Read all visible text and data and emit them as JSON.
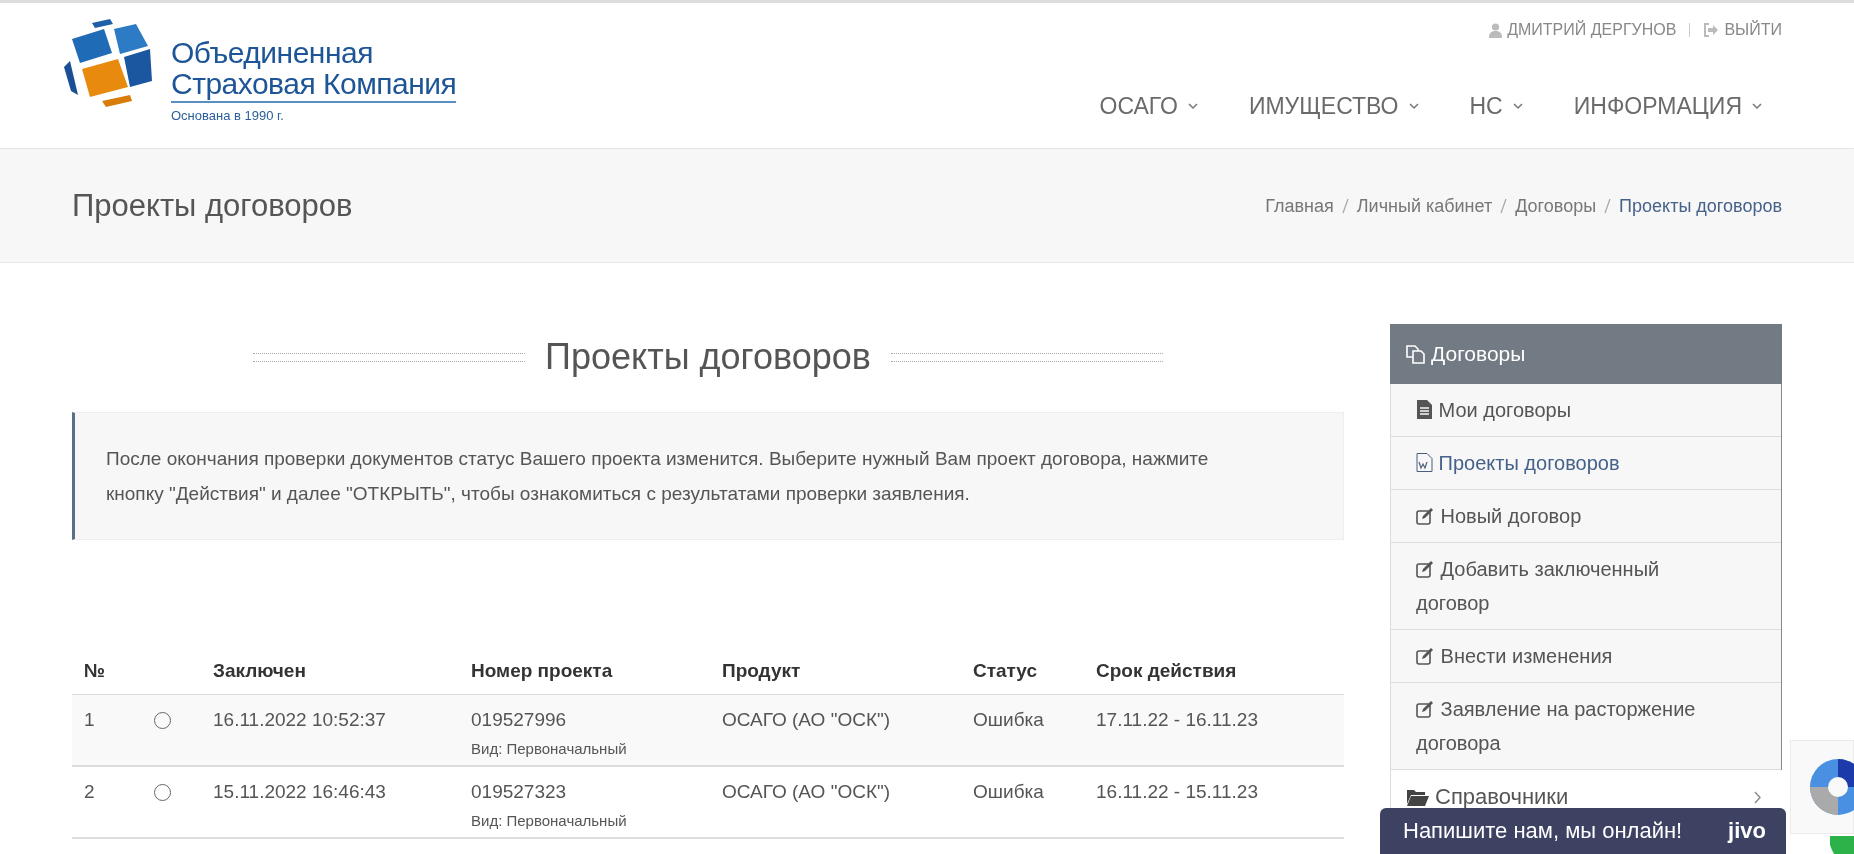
{
  "logo": {
    "line_1": "Объединенная",
    "line_2": "Страховая Компания",
    "tagline": "Основана в 1990 г."
  },
  "user_bar": {
    "user": "ДМИТРИЙ ДЕРГУНОВ",
    "logout": "ВЫЙТИ"
  },
  "nav": [
    {
      "label": "ОСАГО"
    },
    {
      "label": "ИМУЩЕСТВО"
    },
    {
      "label": "НС"
    },
    {
      "label": "ИНФОРМАЦИЯ"
    }
  ],
  "page_title": "Проекты договоров",
  "breadcrumb": [
    {
      "label": "Главная",
      "selected": false
    },
    {
      "label": "Личный кабинет",
      "selected": false
    },
    {
      "label": "Договоры",
      "selected": false
    },
    {
      "label": "Проекты договоров",
      "selected": true
    }
  ],
  "heading": "Проекты договоров",
  "notice": "После окончания проверки документов статус Вашего проекта изменится. Выберите нужный Вам проект договора, нажмите кнопку \"Действия\" и далее \"ОТКРЫТЬ\", чтобы ознакомиться с результатами проверки заявления.",
  "table": {
    "columns": [
      "№",
      "",
      "Заключен",
      "Номер проекта",
      "Продукт",
      "Статус",
      "Срок действия"
    ],
    "rows": [
      {
        "number": "1",
        "checked": false,
        "concluded": "16.11.2022 10:52:37",
        "project": "019527996",
        "kind_label": "Вид: Первоначальный",
        "product": "ОСАГО (АО \"ОСК\")",
        "status": "Ошибка",
        "period": "17.11.22 - 16.11.23"
      },
      {
        "number": "2",
        "checked": false,
        "concluded": "15.11.2022 16:46:43",
        "project": "019527323",
        "kind_label": "Вид: Первоначальный",
        "product": "ОСАГО (АО \"ОСК\")",
        "status": "Ошибка",
        "period": "16.11.22 - 15.11.23"
      }
    ]
  },
  "sidebar": {
    "title": "Договоры",
    "items": [
      {
        "label": "Мои договоры",
        "kind": "file",
        "selected": false
      },
      {
        "label": "Проекты договоров",
        "kind": "word",
        "selected": true
      },
      {
        "label": "Новый договор",
        "kind": "edit",
        "selected": false
      },
      {
        "label": "Добавить заключенный договор",
        "kind": "edit",
        "selected": false
      },
      {
        "label": "Внести изменения",
        "kind": "edit",
        "selected": false
      },
      {
        "label": "Заявление на расторжение договора",
        "kind": "edit",
        "selected": false
      }
    ],
    "section": {
      "label": "Справочники",
      "expanded": false
    }
  },
  "chat": {
    "label": "Напишите нам, мы онлайн!",
    "brand": "jivo"
  }
}
